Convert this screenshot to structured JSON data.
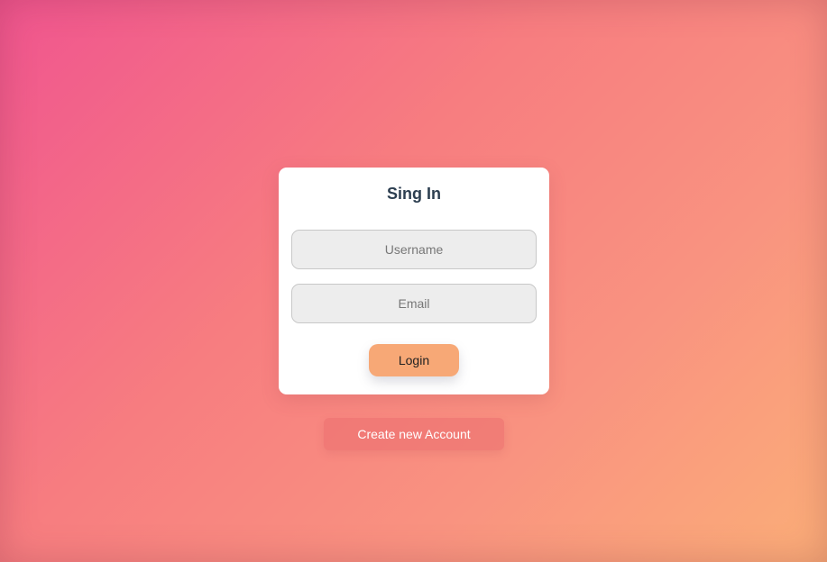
{
  "login_form": {
    "title": "Sing In",
    "username": {
      "placeholder": "Username",
      "value": ""
    },
    "email": {
      "placeholder": "Email",
      "value": ""
    },
    "login_label": "Login"
  },
  "create_account_label": "Create new Account",
  "colors": {
    "background_start": "#f0558f",
    "background_end": "#fbae78",
    "card": "#ffffff",
    "login_button": "#f7a876",
    "title_text": "#2c3e50"
  }
}
